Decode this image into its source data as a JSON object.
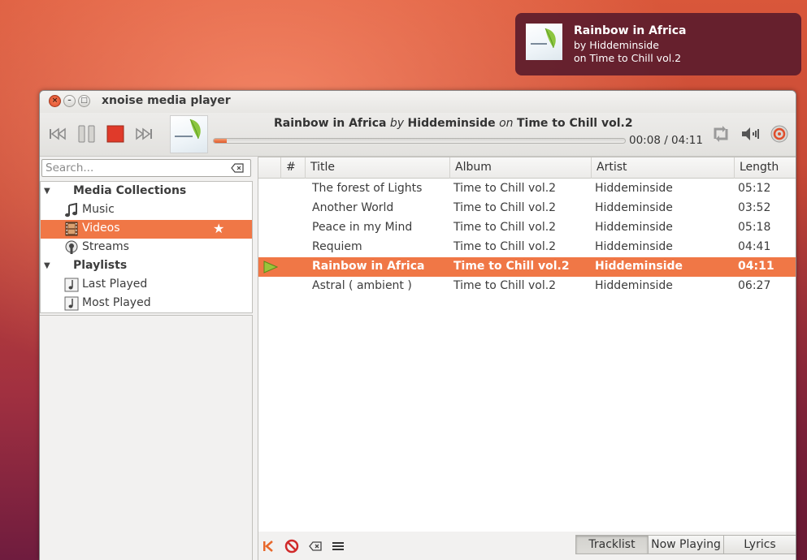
{
  "notification": {
    "title": "Rainbow in Africa",
    "line2": "by Hiddeminside",
    "line3": "on Time to Chill vol.2"
  },
  "window": {
    "title": "xnoise media player",
    "close_glyph": "×",
    "min_glyph": "–",
    "max_glyph": "□"
  },
  "now_playing": {
    "title": "Rainbow in Africa",
    "by_word": "by",
    "artist": "Hiddeminside",
    "on_word": "on",
    "album": "Time to Chill vol.2",
    "time": "00:08 / 04:11",
    "progress_fraction": 0.032
  },
  "search": {
    "placeholder": "Search..."
  },
  "tree": {
    "media_header": "Media Collections",
    "items": [
      {
        "label": "Music",
        "icon": "music-note-icon"
      },
      {
        "label": "Videos",
        "icon": "film-icon",
        "selected": true
      },
      {
        "label": "Streams",
        "icon": "stream-icon"
      }
    ],
    "playlists_header": "Playlists",
    "playlists": [
      {
        "label": "Last Played",
        "icon": "playlist-icon"
      },
      {
        "label": "Most Played",
        "icon": "playlist-icon"
      }
    ],
    "star_glyph": "★"
  },
  "columns": [
    "#",
    "Title",
    "Album",
    "Artist",
    "Length"
  ],
  "tracks": [
    {
      "title": "The forest of Lights",
      "album": "Time to Chill vol.2",
      "artist": "Hiddeminside",
      "length": "05:12"
    },
    {
      "title": "Another World",
      "album": "Time to Chill vol.2",
      "artist": "Hiddeminside",
      "length": "03:52"
    },
    {
      "title": "Peace in my Mind",
      "album": "Time to Chill vol.2",
      "artist": "Hiddeminside",
      "length": "05:18"
    },
    {
      "title": "Requiem",
      "album": "Time to Chill vol.2",
      "artist": "Hiddeminside",
      "length": "04:41"
    },
    {
      "title": "Rainbow in Africa",
      "album": "Time to Chill vol.2",
      "artist": "Hiddeminside",
      "length": "04:11",
      "playing": true
    },
    {
      "title": "Astral ( ambient )",
      "album": "Time to Chill vol.2",
      "artist": "Hiddeminside",
      "length": "06:27"
    }
  ],
  "tabs": [
    "Tracklist",
    "Now Playing",
    "Lyrics"
  ],
  "colors": {
    "accent": "#f07746",
    "notification_bg": "#5c1c2c"
  }
}
